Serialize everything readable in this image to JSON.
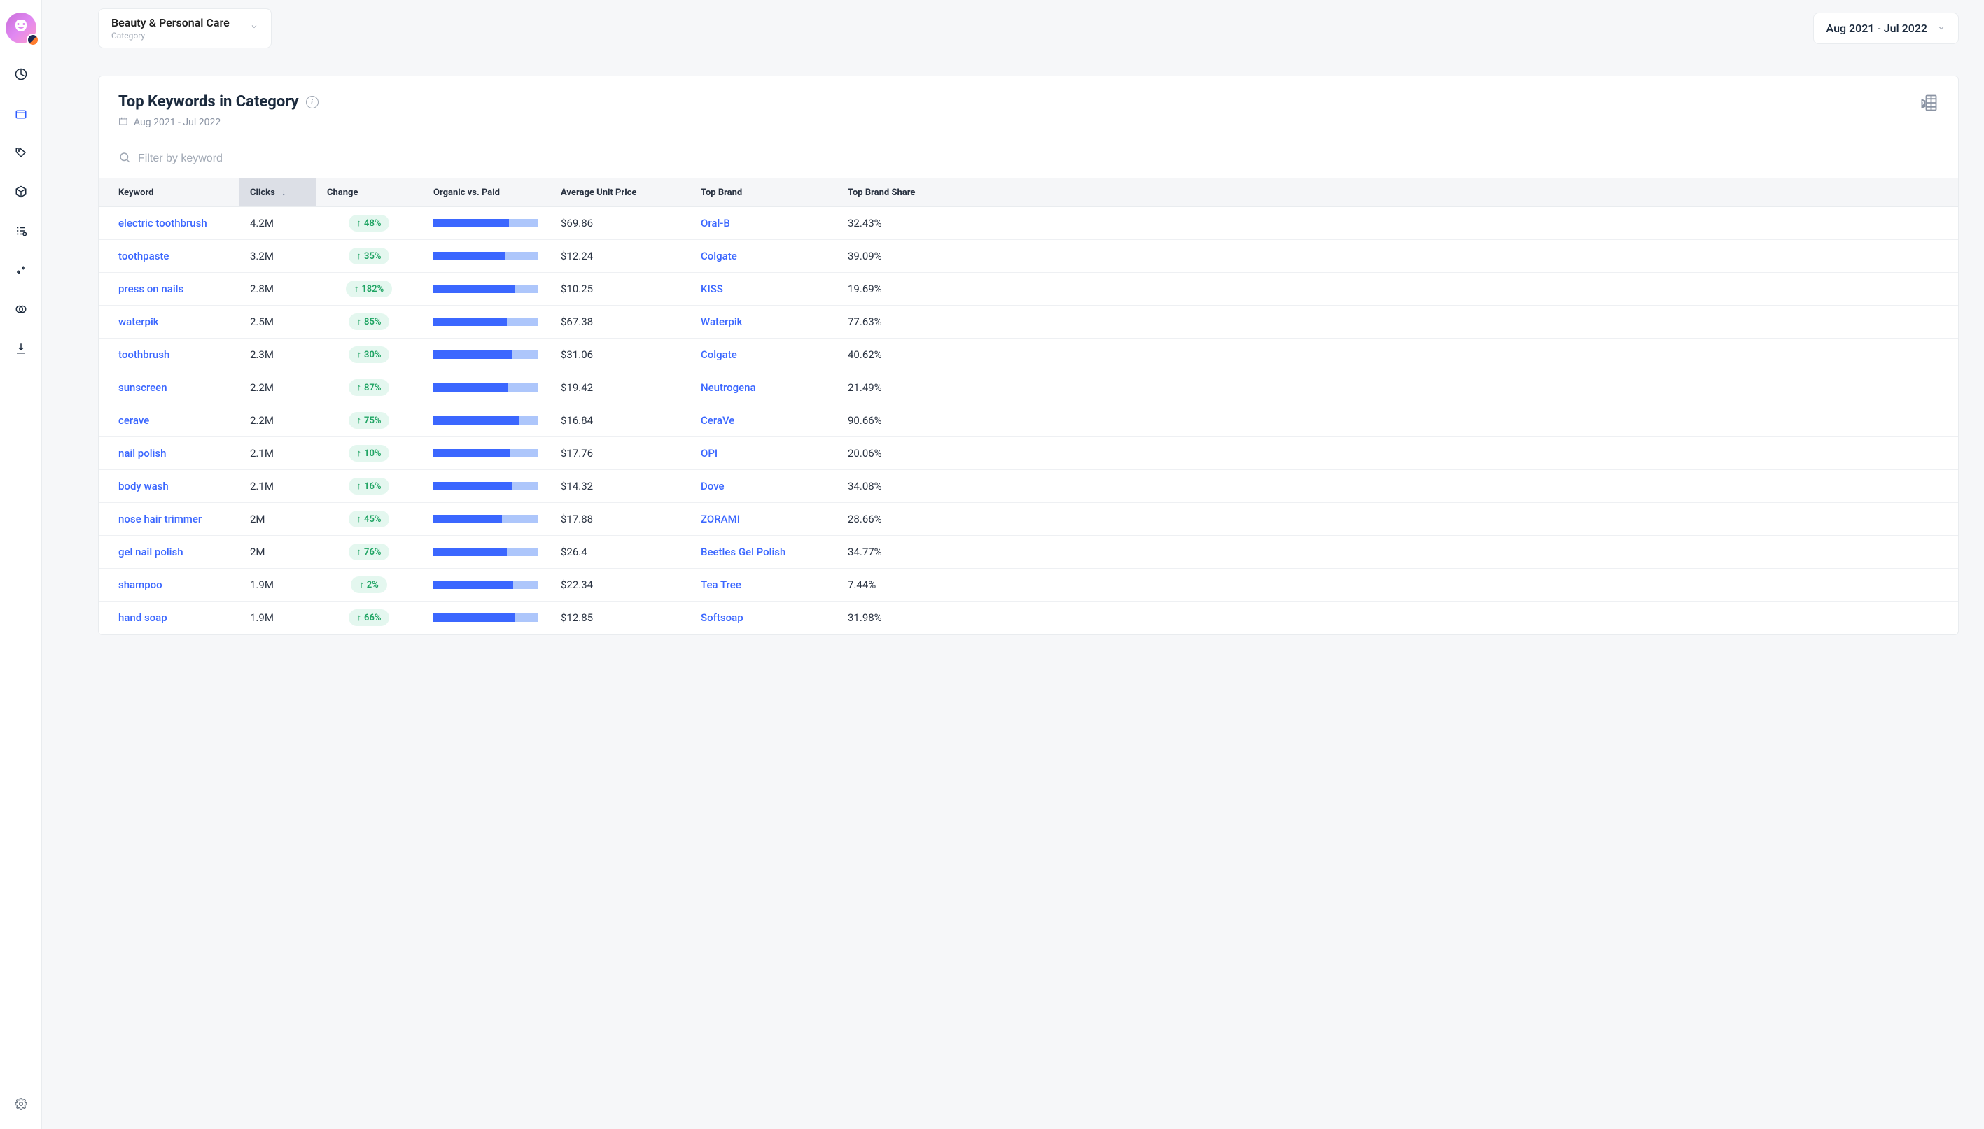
{
  "header": {
    "category_label": "Beauty & Personal Care",
    "category_sub": "Category",
    "date_range": "Aug 2021 - Jul 2022"
  },
  "panel": {
    "title": "Top Keywords in Category",
    "date_range": "Aug 2021 - Jul 2022",
    "filter_placeholder": "Filter by keyword"
  },
  "columns": {
    "keyword": "Keyword",
    "clicks": "Clicks",
    "change": "Change",
    "org_vs_paid": "Organic vs. Paid",
    "avg_price": "Average Unit Price",
    "top_brand": "Top Brand",
    "top_brand_share": "Top Brand Share"
  },
  "rows": [
    {
      "keyword": "electric toothbrush",
      "clicks": "4.2M",
      "change": "48%",
      "organic_pct": 72,
      "price": "$69.86",
      "brand": "Oral-B",
      "share": "32.43%"
    },
    {
      "keyword": "toothpaste",
      "clicks": "3.2M",
      "change": "35%",
      "organic_pct": 68,
      "price": "$12.24",
      "brand": "Colgate",
      "share": "39.09%"
    },
    {
      "keyword": "press on nails",
      "clicks": "2.8M",
      "change": "182%",
      "organic_pct": 77,
      "price": "$10.25",
      "brand": "KISS",
      "share": "19.69%"
    },
    {
      "keyword": "waterpik",
      "clicks": "2.5M",
      "change": "85%",
      "organic_pct": 70,
      "price": "$67.38",
      "brand": "Waterpik",
      "share": "77.63%"
    },
    {
      "keyword": "toothbrush",
      "clicks": "2.3M",
      "change": "30%",
      "organic_pct": 75,
      "price": "$31.06",
      "brand": "Colgate",
      "share": "40.62%"
    },
    {
      "keyword": "sunscreen",
      "clicks": "2.2M",
      "change": "87%",
      "organic_pct": 71,
      "price": "$19.42",
      "brand": "Neutrogena",
      "share": "21.49%"
    },
    {
      "keyword": "cerave",
      "clicks": "2.2M",
      "change": "75%",
      "organic_pct": 82,
      "price": "$16.84",
      "brand": "CeraVe",
      "share": "90.66%"
    },
    {
      "keyword": "nail polish",
      "clicks": "2.1M",
      "change": "10%",
      "organic_pct": 73,
      "price": "$17.76",
      "brand": "OPI",
      "share": "20.06%"
    },
    {
      "keyword": "body wash",
      "clicks": "2.1M",
      "change": "16%",
      "organic_pct": 75,
      "price": "$14.32",
      "brand": "Dove",
      "share": "34.08%"
    },
    {
      "keyword": "nose hair trimmer",
      "clicks": "2M",
      "change": "45%",
      "organic_pct": 65,
      "price": "$17.88",
      "brand": "ZORAMI",
      "share": "28.66%"
    },
    {
      "keyword": "gel nail polish",
      "clicks": "2M",
      "change": "76%",
      "organic_pct": 70,
      "price": "$26.4",
      "brand": "Beetles Gel Polish",
      "share": "34.77%"
    },
    {
      "keyword": "shampoo",
      "clicks": "1.9M",
      "change": "2%",
      "organic_pct": 76,
      "price": "$22.34",
      "brand": "Tea Tree",
      "share": "7.44%"
    },
    {
      "keyword": "hand soap",
      "clicks": "1.9M",
      "change": "66%",
      "organic_pct": 78,
      "price": "$12.85",
      "brand": "Softsoap",
      "share": "31.98%"
    }
  ]
}
